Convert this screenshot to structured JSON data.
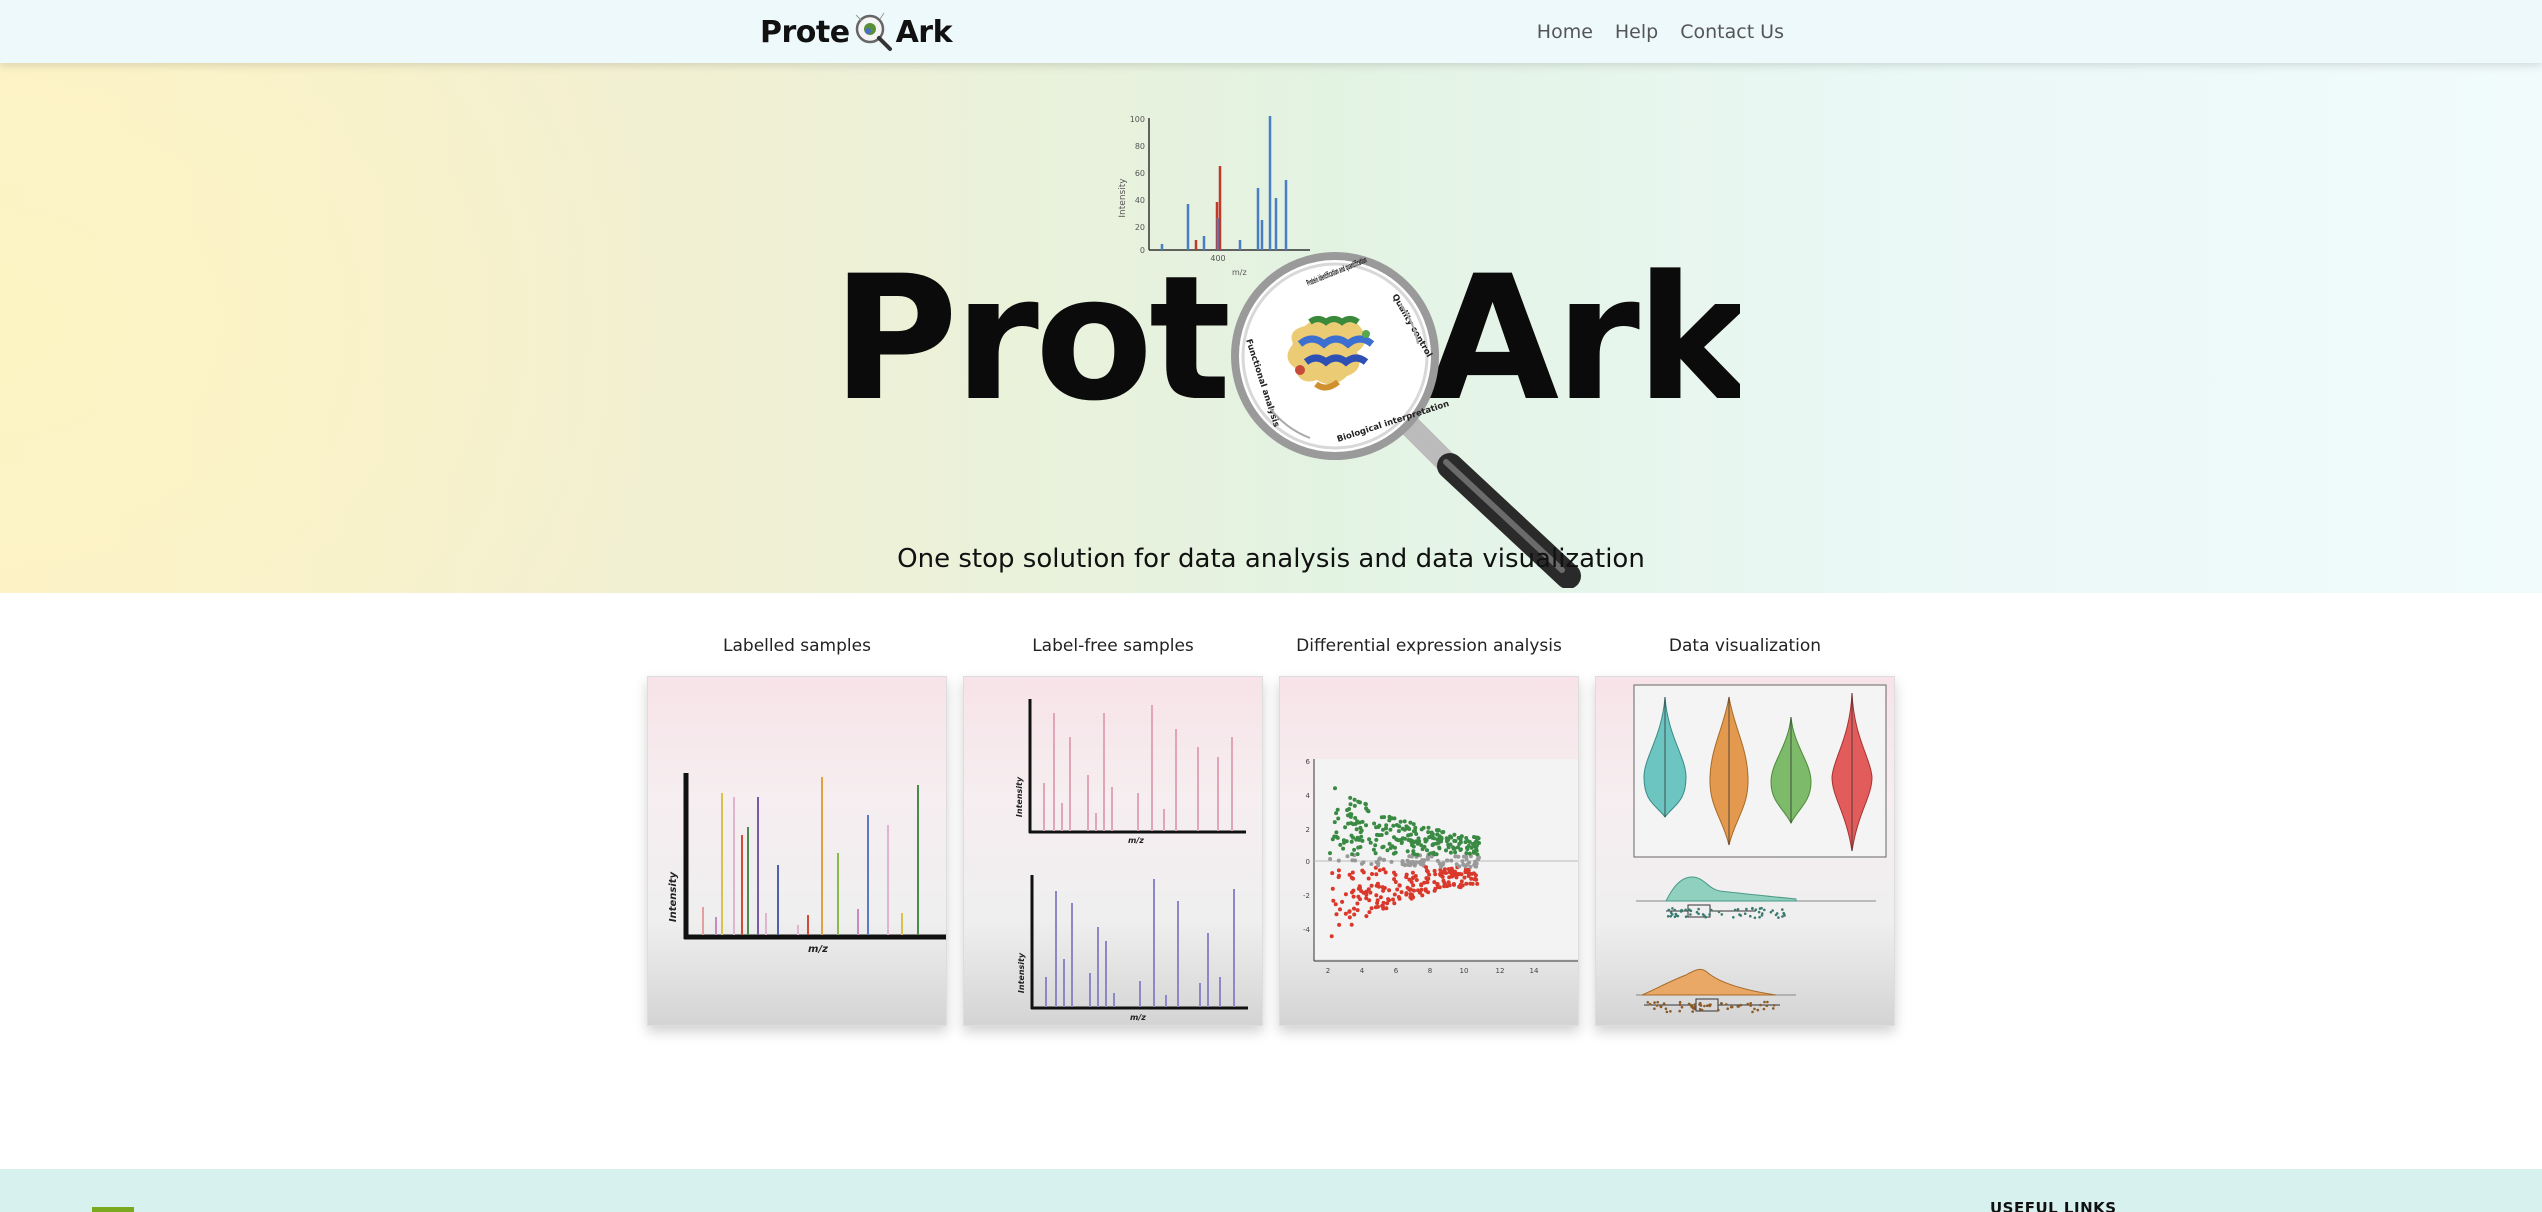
{
  "nav": {
    "brand_left": "Prote",
    "brand_right": "Ark",
    "links": [
      "Home",
      "Help",
      "Contact Us"
    ]
  },
  "hero": {
    "title_left": "Prote",
    "title_right": "Ark",
    "tagline": "One stop solution for data analysis and data visualization",
    "lens_labels": [
      "Protein identification and quantification",
      "Quality control",
      "Biological interpretation",
      "Functional analysis"
    ],
    "spectrum": {
      "ylabel": "Intensity",
      "xlabel": "m/z",
      "y_ticks": [
        "100",
        "80",
        "60",
        "40",
        "20",
        "0"
      ],
      "x_tick": "400"
    }
  },
  "cards": [
    {
      "title": "Labelled samples",
      "xlabel": "m/z",
      "ylabel": "Intensity"
    },
    {
      "title": "Label-free samples",
      "xlabel": "m/z",
      "ylabel": "Intensity"
    },
    {
      "title": "Differential expression analysis",
      "y_ticks": [
        "6",
        "4",
        "2",
        "0",
        "-2",
        "-4"
      ],
      "x_ticks": [
        "2",
        "4",
        "6",
        "8",
        "10",
        "12",
        "14"
      ]
    },
    {
      "title": "Data visualization"
    }
  ],
  "footer": {
    "heading": "USEFUL LINKS"
  },
  "colors": {
    "green": "#3a8a44",
    "red": "#d9382a",
    "teal": "#6cc5c0",
    "orange": "#e39a4e",
    "light_green": "#7dbb6a",
    "coral": "#e35c5c"
  }
}
